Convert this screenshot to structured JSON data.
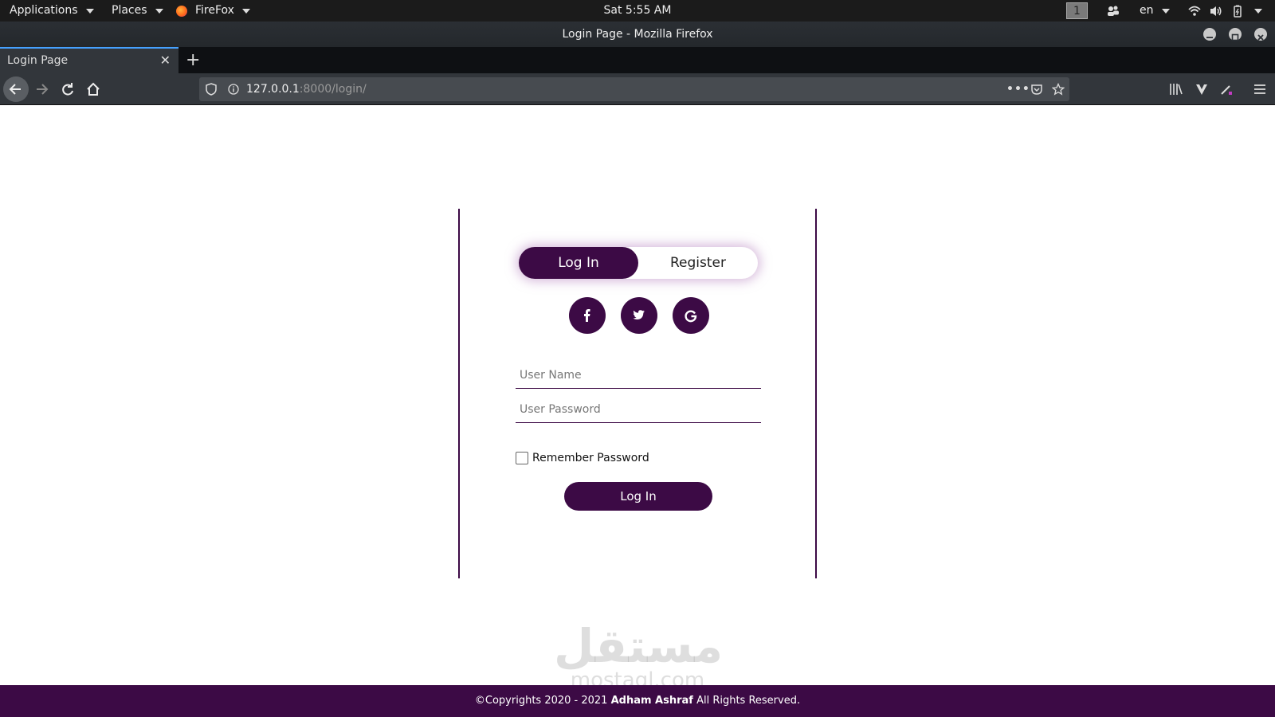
{
  "topbar": {
    "applications": "Applications",
    "places": "Places",
    "firefox": "FireFox",
    "clock": "Sat  5:55 AM",
    "workspace": "1",
    "language": "en"
  },
  "window": {
    "title": "Login Page - Mozilla Firefox"
  },
  "tabs": [
    {
      "label": "Login Page"
    }
  ],
  "urlbar": {
    "host": "127.0.0.1",
    "path": ":8000/login/"
  },
  "login": {
    "toggle_login": "Log In",
    "toggle_register": "Register",
    "social": [
      {
        "name": "facebook",
        "glyph": "f"
      },
      {
        "name": "twitter",
        "glyph": "t"
      },
      {
        "name": "google",
        "glyph": "G"
      }
    ],
    "username_placeholder": "User Name",
    "password_placeholder": "User Password",
    "remember_label": "Remember Password",
    "submit_label": "Log In"
  },
  "watermark": {
    "arabic": "مستقل",
    "latin": "mostaql.com"
  },
  "footer": {
    "prefix": "©Copyrights 2020 - 2021 ",
    "author": "Adham Ashraf",
    "suffix": " All Rights Reserved."
  },
  "colors": {
    "brand": "#3c0a45",
    "topbar": "#1b1b1b",
    "browser_chrome": "#32363b",
    "tab_accent": "#45a1ff"
  }
}
